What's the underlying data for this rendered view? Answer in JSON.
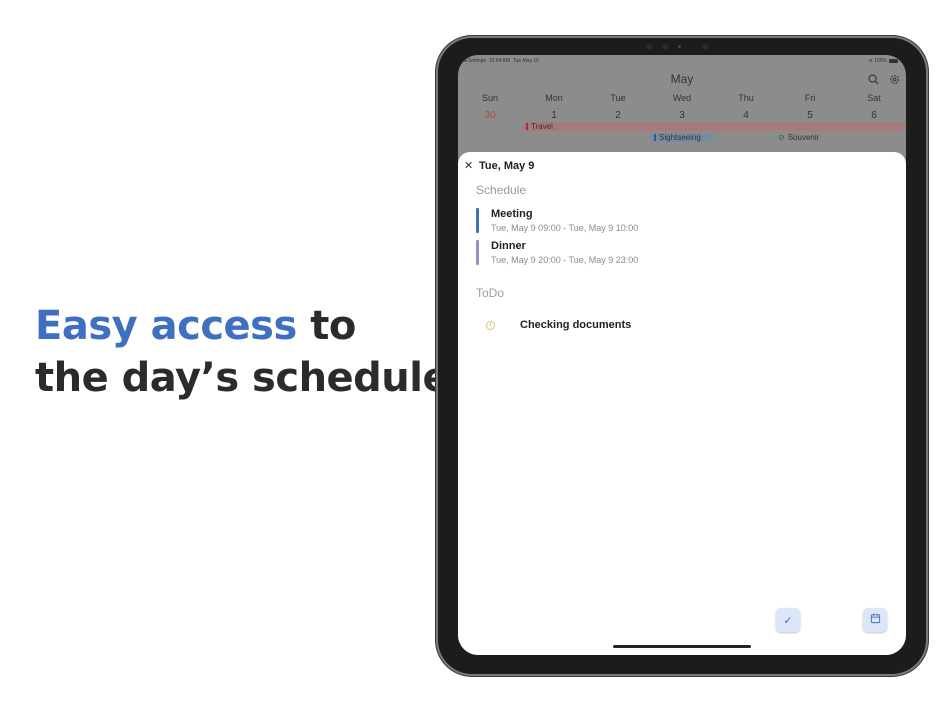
{
  "headline": {
    "accent": "Easy access",
    "rest_line1": " to",
    "line2": "the day’s schedule"
  },
  "statusbar": {
    "back_app": "Settings",
    "time": "10:54 AM",
    "date": "Tue May 16",
    "battery": "100%"
  },
  "calendar": {
    "month": "May",
    "weekdays": [
      "Sun",
      "Mon",
      "Tue",
      "Wed",
      "Thu",
      "Fri",
      "Sat"
    ],
    "dates": [
      "30",
      "1",
      "2",
      "3",
      "4",
      "5",
      "6"
    ],
    "events": {
      "travel": "Travel",
      "sightseeing": "Sightseeing",
      "souvenir": "Souvenir"
    }
  },
  "sheet": {
    "title": "Tue, May 9",
    "schedule_label": "Schedule",
    "schedule": [
      {
        "name": "Meeting",
        "time": "Tue, May 9 09:00 - Tue, May 9 10:00",
        "color": "#3f6fbf"
      },
      {
        "name": "Dinner",
        "time": "Tue, May 9 20:00 - Tue, May 9 23:00",
        "color": "#9a8cc8"
      }
    ],
    "todo_label": "ToDo",
    "todos": [
      {
        "name": "Checking documents"
      }
    ]
  },
  "colors": {
    "accent": "#3f6fbf",
    "headline_text": "#2b2b2b",
    "sunday_red": "#a74a4a"
  },
  "icons": {
    "search": "search-icon",
    "settings": "gear-icon",
    "close": "close-icon",
    "add_todo": "checkmark-icon",
    "add_event": "calendar-icon"
  }
}
